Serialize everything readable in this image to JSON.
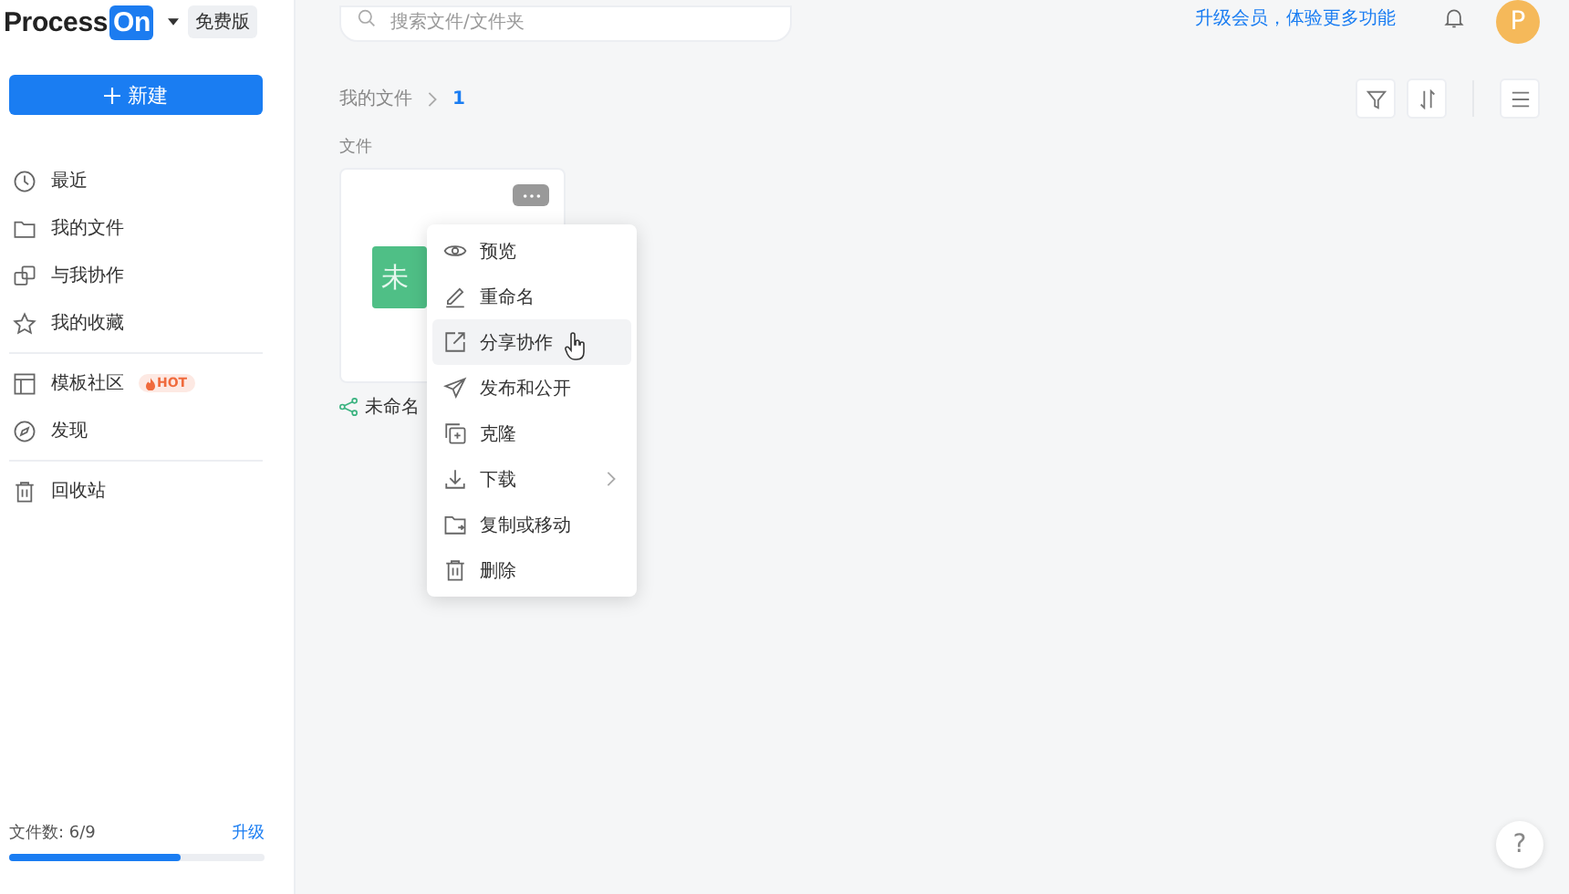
{
  "logo": {
    "name": "Process",
    "highlight": "On"
  },
  "plan_badge": "免费版",
  "new_button": "新建",
  "nav": [
    {
      "label": "最近"
    },
    {
      "label": "我的文件"
    },
    {
      "label": "与我协作"
    },
    {
      "label": "我的收藏"
    },
    {
      "label": "模板社区",
      "badge": "HOT"
    },
    {
      "label": "发现"
    },
    {
      "label": "回收站"
    }
  ],
  "quota": {
    "label": "文件数: 6/9",
    "link": "升级",
    "level": 0.67
  },
  "search": {
    "placeholder": "搜索文件/文件夹"
  },
  "upgrade_link": "升级会员，体验更多功能",
  "avatar": "P",
  "breadcrumb": [
    "我的文件",
    "1"
  ],
  "section_label": "文件",
  "file": {
    "thumb_text": "未",
    "name": "未命名"
  },
  "menu": [
    {
      "label": "预览",
      "hovered": false
    },
    {
      "label": "重命名",
      "hovered": false
    },
    {
      "label": "分享协作",
      "hovered": true
    },
    {
      "label": "发布和公开",
      "hovered": false
    },
    {
      "label": "克隆",
      "hovered": false
    },
    {
      "label": "下载",
      "hovered": false,
      "submenu": true
    },
    {
      "label": "复制或移动",
      "hovered": false
    },
    {
      "label": "删除",
      "hovered": false
    }
  ],
  "help": "?"
}
